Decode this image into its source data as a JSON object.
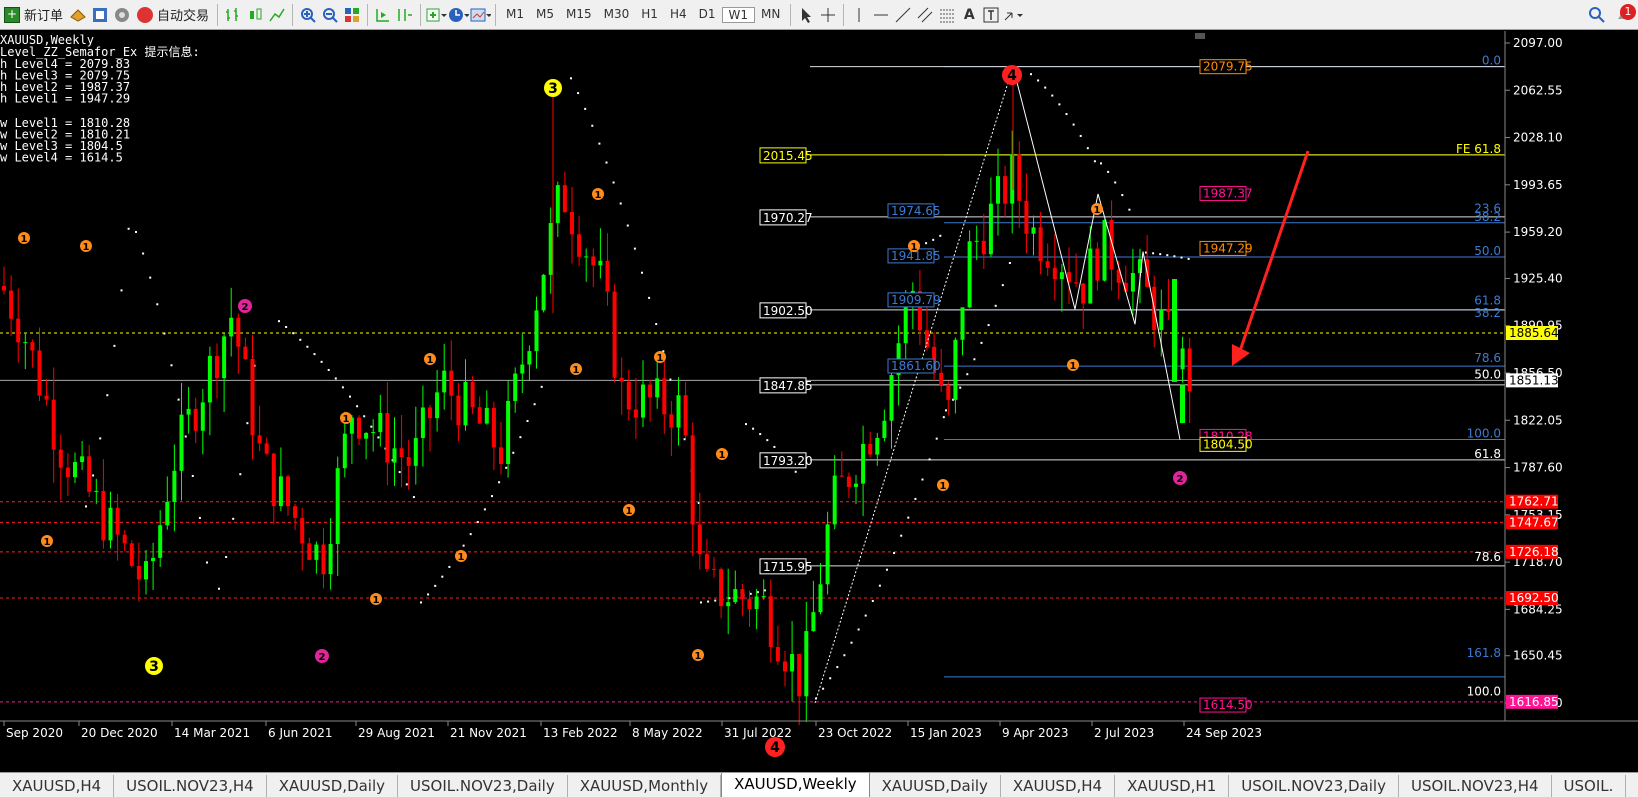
{
  "toolbar": {
    "new_order": "新订单",
    "auto_trade": "自动交易",
    "timeframes": [
      "M1",
      "M5",
      "M15",
      "M30",
      "H1",
      "H4",
      "D1",
      "W1",
      "MN"
    ],
    "alert_count": "1"
  },
  "chart": {
    "symbol_title": "XAUUSD,Weekly",
    "indicator_info": "Level_ZZ_Semafor_Ex 提示信息:",
    "high_levels": [
      "h Level4 = 2079.83",
      "h Level3 = 2079.75",
      "h Level2 = 1987.37",
      "h Level1 = 1947.29"
    ],
    "low_levels": [
      "w Level1 = 1810.28",
      "w Level2 = 1810.21",
      "w Level3 = 1804.5",
      "w Level4 = 1614.5"
    ],
    "price_axis": [
      "2097.00",
      "2062.55",
      "2028.10",
      "1993.65",
      "1959.20",
      "1925.40",
      "1890.95",
      "1856.50",
      "1822.05",
      "1787.60",
      "1753.15",
      "1718.70",
      "1684.25",
      "1650.45",
      "1616.00"
    ],
    "time_axis": [
      "Sep 2020",
      "20 Dec 2020",
      "14 Mar 2021",
      "6 Jun 2021",
      "29 Aug 2021",
      "21 Nov 2021",
      "13 Feb 2022",
      "8 May 2022",
      "31 Jul 2022",
      "23 Oct 2022",
      "15 Jan 2023",
      "9 Apr 2023",
      "2 Jul 2023",
      "24 Sep 2023"
    ],
    "axis_tags": [
      {
        "label": "1885.64",
        "color": "#ffff00",
        "text_color": "#000"
      },
      {
        "label": "1851.13",
        "color": "#ffffff",
        "text_color": "#000"
      },
      {
        "label": "1762.71",
        "color": "#ff0000",
        "text_color": "#fff"
      },
      {
        "label": "1747.67",
        "color": "#ff0000",
        "text_color": "#fff"
      },
      {
        "label": "1726.18",
        "color": "#ff0000",
        "text_color": "#fff"
      },
      {
        "label": "1692.50",
        "color": "#ff0000",
        "text_color": "#fff"
      },
      {
        "label": "1616.85",
        "color": "#ff1493",
        "text_color": "#fff"
      }
    ],
    "left_level_boxes": [
      "2015.45",
      "1970.27",
      "1902.50",
      "1847.85",
      "1793.20",
      "1715.95"
    ],
    "fib_inner_boxes": [
      "1974.65",
      "1941.85",
      "1909.79",
      "1861.60"
    ],
    "fib_ratios_right": [
      "0.0",
      "FE 61.8",
      "23.6",
      "38.2",
      "50.0",
      "61.8",
      "38.2",
      "78.6",
      "50.0",
      "100.0",
      "61.8",
      "78.6",
      "161.8",
      "100.0"
    ],
    "price_tags_mid": [
      {
        "label": "2079.75",
        "color": "#ff8c00"
      },
      {
        "label": "1987.37",
        "color": "#ff1493"
      },
      {
        "label": "1947.29",
        "color": "#ff8c00"
      },
      {
        "label": "1810.28",
        "color": "#ff1493"
      },
      {
        "label": "1804.50",
        "color": "#ffff00"
      },
      {
        "label": "1614.50",
        "color": "#ff1493"
      }
    ],
    "semafor_labels": [
      "1",
      "2",
      "3",
      "4"
    ]
  },
  "tabs": [
    "XAUUSD,H4",
    "USOIL.NOV23,H4",
    "XAUUSD,Daily",
    "USOIL.NOV23,Daily",
    "XAUUSD,Monthly",
    "XAUUSD,Weekly",
    "XAUUSD,Daily",
    "XAUUSD,H4",
    "XAUUSD,H1",
    "USOIL.NOV23,Daily",
    "USOIL.NOV23,H4",
    "USOIL."
  ],
  "active_tab": 5,
  "colors": {
    "bull": "#00ff00",
    "bear": "#ff0000",
    "fib_blue": "#3a7bd5",
    "grid": "#333333"
  }
}
